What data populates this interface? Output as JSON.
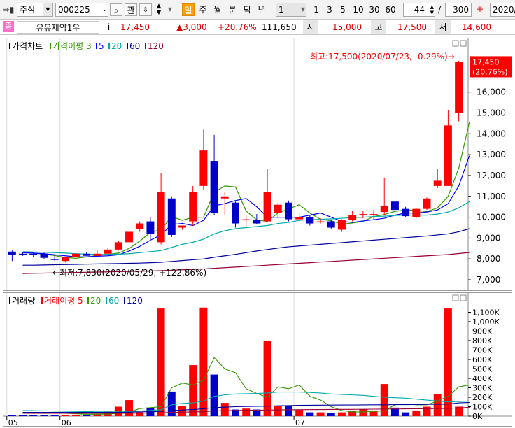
{
  "toolbar": {
    "market": "주식",
    "code": "000225",
    "btn_related": "관",
    "period_active": "일",
    "periods": [
      "주",
      "월",
      "분",
      "틱",
      "년"
    ],
    "interval_value": "1",
    "quick_intervals": [
      "1",
      "3",
      "5",
      "10",
      "30",
      "60"
    ],
    "bar_count": "44",
    "bar_total": "300",
    "date_text": "2020/"
  },
  "quote": {
    "badge": "종",
    "name": "유유제약1우",
    "info_btn": "i",
    "price": "17,450",
    "change": "▲3,000",
    "change_pct": "+20.76%",
    "volume": "111,650",
    "open_label": "시",
    "open": "15,000",
    "high_label": "고",
    "high": "17,500",
    "low_label": "저",
    "low": "14,600"
  },
  "colors": {
    "up": "#ff0000",
    "down": "#0000cc",
    "ma3": "#339900",
    "ma5": "#0000ff",
    "ma20": "#00aaaa",
    "ma60": "#000099",
    "ma120": "#990033",
    "axis": "#000000"
  },
  "chart_data": [
    {
      "type": "candlestick",
      "legend": {
        "main": "가격차트",
        "ma_label": "가격이평",
        "periods": [
          "3",
          "5",
          "20",
          "60",
          "120"
        ]
      },
      "ylim": [
        6700,
        17900
      ],
      "yticks": [
        7000,
        8000,
        9000,
        10000,
        11000,
        12000,
        13000,
        14000,
        15000,
        16000
      ],
      "ytick_labels": [
        "7,000",
        "8,000",
        "9,000",
        "10,000",
        "11,000",
        "12,000",
        "13,000",
        "14,000",
        "15,000",
        "16,000"
      ],
      "last_price_tag": [
        "17,450",
        "(20.76%)"
      ],
      "annotations": {
        "high": "최고:17,500(2020/07/23, -0.29%)→",
        "low": "←최저:7,830(2020/05/29, +122.86%)"
      },
      "candles": [
        {
          "o": 8350,
          "h": 8400,
          "l": 7900,
          "c": 8200
        },
        {
          "o": 8250,
          "h": 8300,
          "l": 8150,
          "c": 8220
        },
        {
          "o": 8250,
          "h": 8300,
          "l": 8100,
          "c": 8200
        },
        {
          "o": 8250,
          "h": 8300,
          "l": 8000,
          "c": 8050
        },
        {
          "o": 8000,
          "h": 8200,
          "l": 7900,
          "c": 7950
        },
        {
          "o": 7900,
          "h": 8100,
          "l": 7830,
          "c": 8080
        },
        {
          "o": 8100,
          "h": 8250,
          "l": 8000,
          "c": 8250
        },
        {
          "o": 8250,
          "h": 8350,
          "l": 8150,
          "c": 8150
        },
        {
          "o": 8150,
          "h": 8400,
          "l": 8100,
          "c": 8250
        },
        {
          "o": 8250,
          "h": 8550,
          "l": 8200,
          "c": 8450
        },
        {
          "o": 8450,
          "h": 8850,
          "l": 8400,
          "c": 8800
        },
        {
          "o": 8800,
          "h": 9400,
          "l": 8700,
          "c": 9300
        },
        {
          "o": 9450,
          "h": 9800,
          "l": 9300,
          "c": 9700
        },
        {
          "o": 9800,
          "h": 10000,
          "l": 8950,
          "c": 9200
        },
        {
          "o": 8800,
          "h": 12100,
          "l": 8700,
          "c": 11200
        },
        {
          "o": 10900,
          "h": 11000,
          "l": 9050,
          "c": 9150
        },
        {
          "o": 9500,
          "h": 9600,
          "l": 9400,
          "c": 9600
        },
        {
          "o": 9800,
          "h": 11500,
          "l": 9600,
          "c": 11200
        },
        {
          "o": 11500,
          "h": 14200,
          "l": 11300,
          "c": 13200
        },
        {
          "o": 12700,
          "h": 13950,
          "l": 10100,
          "c": 10200
        },
        {
          "o": 10900,
          "h": 11200,
          "l": 10100,
          "c": 11000
        },
        {
          "o": 10700,
          "h": 10750,
          "l": 9500,
          "c": 9700
        },
        {
          "o": 9850,
          "h": 10100,
          "l": 9550,
          "c": 9900
        },
        {
          "o": 9850,
          "h": 10150,
          "l": 9650,
          "c": 9700
        },
        {
          "o": 9800,
          "h": 12300,
          "l": 9750,
          "c": 11200
        },
        {
          "o": 10200,
          "h": 10700,
          "l": 9950,
          "c": 10600
        },
        {
          "o": 10700,
          "h": 10800,
          "l": 9800,
          "c": 9900
        },
        {
          "o": 9900,
          "h": 10200,
          "l": 9800,
          "c": 10000
        },
        {
          "o": 10000,
          "h": 10100,
          "l": 9600,
          "c": 9700
        },
        {
          "o": 9800,
          "h": 9950,
          "l": 9700,
          "c": 9800
        },
        {
          "o": 9800,
          "h": 9850,
          "l": 9450,
          "c": 9500
        },
        {
          "o": 9400,
          "h": 9900,
          "l": 9300,
          "c": 9850
        },
        {
          "o": 9850,
          "h": 10300,
          "l": 9800,
          "c": 10100
        },
        {
          "o": 10100,
          "h": 10300,
          "l": 9950,
          "c": 10150
        },
        {
          "o": 10100,
          "h": 10350,
          "l": 9900,
          "c": 10150
        },
        {
          "o": 10250,
          "h": 11900,
          "l": 10100,
          "c": 10550
        },
        {
          "o": 10750,
          "h": 10800,
          "l": 10300,
          "c": 10350
        },
        {
          "o": 10400,
          "h": 10500,
          "l": 10000,
          "c": 10050
        },
        {
          "o": 10000,
          "h": 10450,
          "l": 9950,
          "c": 10400
        },
        {
          "o": 10400,
          "h": 10950,
          "l": 10350,
          "c": 10900
        },
        {
          "o": 11500,
          "h": 12300,
          "l": 11400,
          "c": 11750
        },
        {
          "o": 11500,
          "h": 15150,
          "l": 11500,
          "c": 14400
        },
        {
          "o": 15000,
          "h": 17500,
          "l": 14600,
          "c": 17450
        }
      ],
      "ma": [
        {
          "period": "3",
          "color": "#339900",
          "values": [
            8300,
            8280,
            8230,
            8160,
            8070,
            8030,
            8100,
            8160,
            8220,
            8280,
            8500,
            8850,
            9270,
            9400,
            10030,
            9850,
            10000,
            10000,
            11200,
            11500,
            11450,
            10300,
            9870,
            9800,
            10200,
            10400,
            10600,
            10200,
            9900,
            9830,
            9670,
            9720,
            9800,
            10030,
            10130,
            10280,
            10350,
            10330,
            10270,
            10450,
            11000,
            12350,
            14550
          ]
        },
        {
          "period": "5",
          "color": "#0000ff",
          "values": [
            8300,
            8280,
            8250,
            8200,
            8150,
            8100,
            8100,
            8130,
            8150,
            8200,
            8380,
            8600,
            8900,
            9150,
            9650,
            9700,
            9600,
            9850,
            10550,
            10650,
            10800,
            10900,
            10500,
            10000,
            10000,
            10000,
            10000,
            10100,
            10200,
            10000,
            9800,
            9750,
            9820,
            9880,
            9950,
            10100,
            10200,
            10200,
            10250,
            10350,
            10650,
            11500,
            12950
          ]
        },
        {
          "period": "20",
          "color": "#00aaaa",
          "values": [
            8350,
            8330,
            8320,
            8300,
            8280,
            8250,
            8230,
            8220,
            8220,
            8230,
            8250,
            8300,
            8350,
            8400,
            8550,
            8700,
            8800,
            8950,
            9200,
            9350,
            9450,
            9500,
            9550,
            9600,
            9700,
            9750,
            9850,
            9880,
            9900,
            9920,
            9950,
            9980,
            10000,
            10030,
            10050,
            10080,
            10100,
            10100,
            10100,
            10150,
            10250,
            10450,
            10750
          ]
        },
        {
          "period": "60",
          "color": "#000099",
          "values": [
            7700,
            7700,
            7710,
            7720,
            7730,
            7740,
            7750,
            7760,
            7770,
            7780,
            7790,
            7800,
            7820,
            7840,
            7880,
            7920,
            7960,
            8000,
            8080,
            8150,
            8220,
            8300,
            8380,
            8450,
            8520,
            8580,
            8620,
            8660,
            8700,
            8740,
            8780,
            8820,
            8860,
            8900,
            8940,
            8980,
            9020,
            9060,
            9100,
            9150,
            9200,
            9300,
            9450
          ]
        },
        {
          "period": "120",
          "color": "#990033",
          "values": [
            7300,
            7310,
            7320,
            7330,
            7340,
            7350,
            7360,
            7370,
            7380,
            7390,
            7400,
            7410,
            7420,
            7440,
            7460,
            7480,
            7500,
            7520,
            7550,
            7580,
            7610,
            7640,
            7670,
            7700,
            7730,
            7760,
            7790,
            7820,
            7850,
            7880,
            7910,
            7940,
            7970,
            8000,
            8030,
            8060,
            8090,
            8120,
            8150,
            8180,
            8210,
            8260,
            8310
          ]
        }
      ]
    },
    {
      "type": "bar",
      "legend": {
        "main": "거래량",
        "ma_label": "거래이평",
        "periods": [
          "5",
          "20",
          "60",
          "120"
        ]
      },
      "ylim": [
        0,
        1200
      ],
      "yticks": [
        0,
        100,
        200,
        300,
        400,
        500,
        600,
        700,
        800,
        900,
        1000,
        1100
      ],
      "ytick_labels": [
        "0K",
        "100K",
        "200K",
        "300K",
        "400K",
        "500K",
        "600K",
        "700K",
        "800K",
        "900K",
        "1,000K",
        "1,100K"
      ],
      "x_labels": [
        {
          "label": "05",
          "index": 0
        },
        {
          "label": "06",
          "index": 5
        },
        {
          "label": "07",
          "index": 27
        }
      ],
      "volumes": [
        10,
        10,
        10,
        10,
        10,
        10,
        10,
        15,
        20,
        50,
        100,
        170,
        40,
        90,
        1140,
        260,
        110,
        540,
        1150,
        440,
        140,
        70,
        80,
        70,
        800,
        110,
        110,
        70,
        40,
        40,
        30,
        40,
        60,
        70,
        60,
        340,
        90,
        40,
        60,
        100,
        230,
        1140,
        100
      ],
      "ma": [
        {
          "period": "5",
          "color": "#339900",
          "values": [
            40,
            38,
            36,
            34,
            30,
            25,
            20,
            20,
            22,
            30,
            45,
            80,
            90,
            100,
            300,
            350,
            330,
            380,
            620,
            500,
            460,
            290,
            240,
            200,
            310,
            290,
            330,
            210,
            170,
            100,
            60,
            45,
            45,
            50,
            55,
            120,
            130,
            120,
            120,
            160,
            210,
            310,
            330
          ]
        },
        {
          "period": "20",
          "color": "#00aaaa",
          "values": [
            60,
            58,
            56,
            54,
            52,
            50,
            48,
            46,
            45,
            45,
            48,
            55,
            60,
            68,
            120,
            135,
            140,
            160,
            210,
            225,
            235,
            238,
            240,
            245,
            255,
            255,
            255,
            250,
            245,
            235,
            230,
            225,
            220,
            210,
            200,
            195,
            190,
            180,
            170,
            160,
            150,
            155,
            160
          ]
        },
        {
          "period": "60",
          "color": "#000099",
          "values": [
            40,
            40,
            40,
            40,
            40,
            40,
            40,
            40,
            40,
            40,
            42,
            45,
            48,
            50,
            60,
            65,
            70,
            78,
            90,
            95,
            100,
            102,
            104,
            105,
            110,
            112,
            114,
            115,
            116,
            117,
            118,
            118,
            119,
            120,
            120,
            122,
            122,
            123,
            124,
            125,
            127,
            140,
            145
          ]
        },
        {
          "period": "120",
          "color": "#990033",
          "values": [
            30,
            30,
            30,
            30,
            30,
            30,
            30,
            30,
            30,
            30,
            31,
            32,
            33,
            35,
            40,
            42,
            45,
            48,
            55,
            58,
            60,
            62,
            63,
            64,
            66,
            67,
            68,
            69,
            70,
            71,
            72,
            72,
            73,
            74,
            75,
            76,
            77,
            78,
            79,
            80,
            81,
            88,
            92
          ]
        }
      ]
    }
  ]
}
